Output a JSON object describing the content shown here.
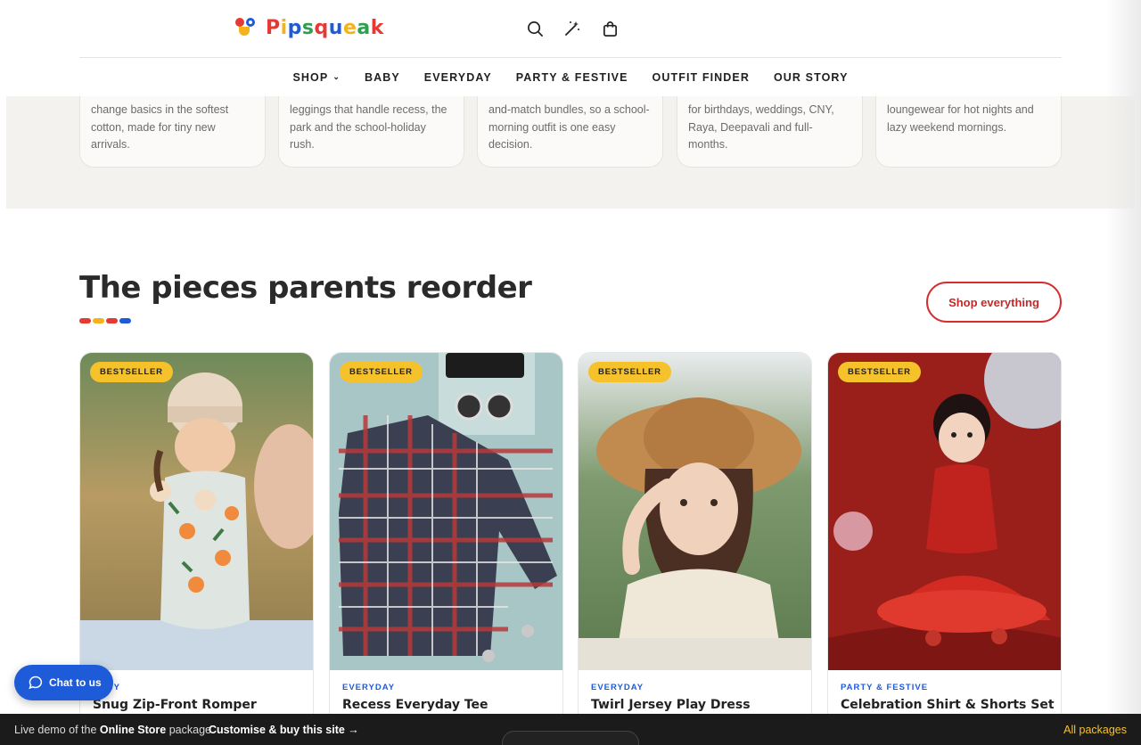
{
  "brand": {
    "name_letters": [
      "P",
      "i",
      "p",
      "s",
      "q",
      "u",
      "e",
      "a",
      "k"
    ],
    "name": "Pipsqueak"
  },
  "nav": {
    "items": [
      {
        "label": "SHOP",
        "has_dropdown": true
      },
      {
        "label": "BABY"
      },
      {
        "label": "EVERYDAY"
      },
      {
        "label": "PARTY & FESTIVE"
      },
      {
        "label": "OUTFIT FINDER"
      },
      {
        "label": "OUR STORY"
      }
    ]
  },
  "header_icons": [
    "search-icon",
    "magic-wand-icon",
    "shopping-bag-icon"
  ],
  "category_cards": [
    {
      "text": "change basics in the softest cotton, made for tiny new arrivals."
    },
    {
      "text": "leggings that handle recess, the park and the school-holiday rush."
    },
    {
      "text": "and-match bundles, so a school-morning outfit is one easy decision."
    },
    {
      "text": "for birthdays, weddings, CNY, Raya, Deepavali and full-months."
    },
    {
      "text": "loungewear for hot nights and lazy weekend mornings."
    }
  ],
  "section": {
    "title": "The pieces parents reorder",
    "cta": "Shop everything",
    "underline_colors": [
      "#e53935",
      "#f5b21b",
      "#e53935",
      "#1e5bd8"
    ]
  },
  "products": [
    {
      "badge": "BESTSELLER",
      "category": "BABY",
      "name": "Snug Zip-Front Romper"
    },
    {
      "badge": "BESTSELLER",
      "category": "EVERYDAY",
      "name": "Recess Everyday Tee"
    },
    {
      "badge": "BESTSELLER",
      "category": "EVERYDAY",
      "name": "Twirl Jersey Play Dress"
    },
    {
      "badge": "BESTSELLER",
      "category": "PARTY & FESTIVE",
      "name": "Celebration Shirt & Shorts Set"
    }
  ],
  "chat": {
    "label": "Chat to us"
  },
  "bottom_bar": {
    "prefix": "Live demo of the",
    "package": "Online Store",
    "suffix": "package.",
    "cta": "Customise & buy this site →",
    "right": "All packages"
  },
  "colors": {
    "accent_red": "#d32f2f",
    "accent_blue": "#1e5bd8",
    "badge_yellow": "#f5c22b"
  }
}
